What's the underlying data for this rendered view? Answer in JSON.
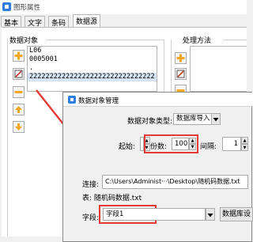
{
  "window": {
    "title": "图形属性"
  },
  "tabs": [
    {
      "label": "基本"
    },
    {
      "label": "文字"
    },
    {
      "label": "条码"
    },
    {
      "label": "数据源"
    }
  ],
  "data_object": {
    "group_label": "数据对象",
    "items": [
      "L06",
      "0005001",
      ".",
      "2222222222222222222222222222222"
    ]
  },
  "processing": {
    "group_label": "处理方法"
  },
  "dialog": {
    "title": "数据对象管理",
    "type_label": "数据对象类型:",
    "type_value": "数据库导入",
    "start_label": "起始:",
    "copies_label": "份数:",
    "copies_value": "100",
    "interval_label": "间隔:",
    "interval_value": "1",
    "connect_label": "连接:",
    "connect_value": "C:\\Users\\Administ···\\Desktop\\随机码数据.txt",
    "table_label": "表: 随机码数据.txt",
    "field_label": "字段:",
    "field_value": "字段1",
    "db_button": "数据库设"
  },
  "colors": {
    "annotation": "#e53935",
    "selection": "#d6e4f5",
    "accent": "#2f7de1"
  }
}
